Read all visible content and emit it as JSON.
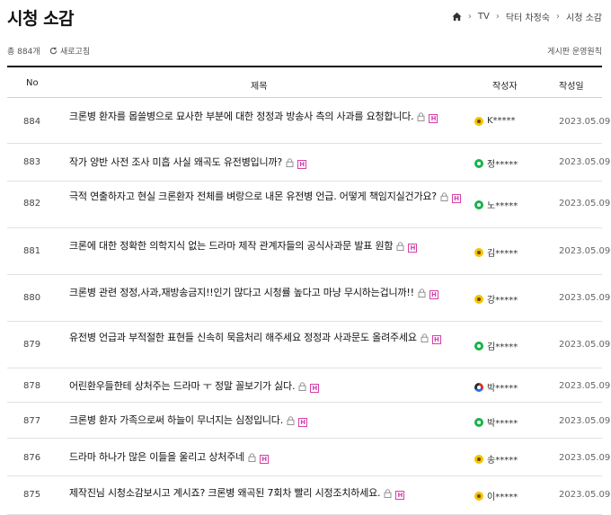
{
  "page": {
    "title": "시청 소감"
  },
  "breadcrumb": [
    "TV",
    "닥터 차정숙",
    "시청 소감"
  ],
  "toolbar": {
    "count": "총 884개",
    "refresh": "새로고침",
    "rules": "게시판 운영원칙"
  },
  "columns": {
    "no": "No",
    "subject": "제목",
    "author": "작성자",
    "date": "작성일"
  },
  "rows": [
    {
      "no": "884",
      "subject": "크론병 환자를 몹쓸병으로 묘사한 부분에 대한 정정과 방송사 측의 사과를 요청합니다.",
      "author": "K*****",
      "date": "2023.05.09",
      "badge": "yellow"
    },
    {
      "no": "883",
      "subject": "작가 양반 사전 조사 미흡 사실 왜곡도 유전병입니까?",
      "author": "정*****",
      "date": "2023.05.09",
      "badge": "green"
    },
    {
      "no": "882",
      "subject": "극적 연출하자고 현실 크론환자 전체를 벼랑으로 내몬 유전병 언급. 어떻게 책임지실건가요?",
      "author": "노*****",
      "date": "2023.05.09",
      "badge": "green"
    },
    {
      "no": "881",
      "subject": "크론에 대한 정확한 의학지식 없는 드라마 제작 관계자들의 공식사과문 발표 원함",
      "author": "김*****",
      "date": "2023.05.09",
      "badge": "yellow"
    },
    {
      "no": "880",
      "subject": "크론병 관련 정정,사과,재방송금지!!인기 많다고 시청률 높다고 마냥 무시하는겁니까!!",
      "author": "강*****",
      "date": "2023.05.09",
      "badge": "yellow"
    },
    {
      "no": "879",
      "subject": "유전병 언급과 부적절한 표현들 신속히 묵음처리 해주세요 정정과 사과문도 올려주세요",
      "author": "김*****",
      "date": "2023.05.09",
      "badge": "green"
    },
    {
      "no": "878",
      "subject": "어린환우들한테 상처주는 드라마 ㅜ 정말 꼴보기가 싫다.",
      "author": "박*****",
      "date": "2023.05.09",
      "badge": "multi"
    },
    {
      "no": "877",
      "subject": "크론병 환자 가족으로써 하늘이 무너지는 심정입니다.",
      "author": "박*****",
      "date": "2023.05.09",
      "badge": "green"
    },
    {
      "no": "876",
      "subject": "드라마 하나가 많은 이들을 울리고 상처주네",
      "author": "송*****",
      "date": "2023.05.09",
      "badge": "yellow"
    },
    {
      "no": "875",
      "subject": "제작진님 시청소감보시고 계시죠? 크론병 왜곡된 7회차 빨리 시정조치하세요.",
      "author": "이*****",
      "date": "2023.05.09",
      "badge": "yellow"
    }
  ]
}
